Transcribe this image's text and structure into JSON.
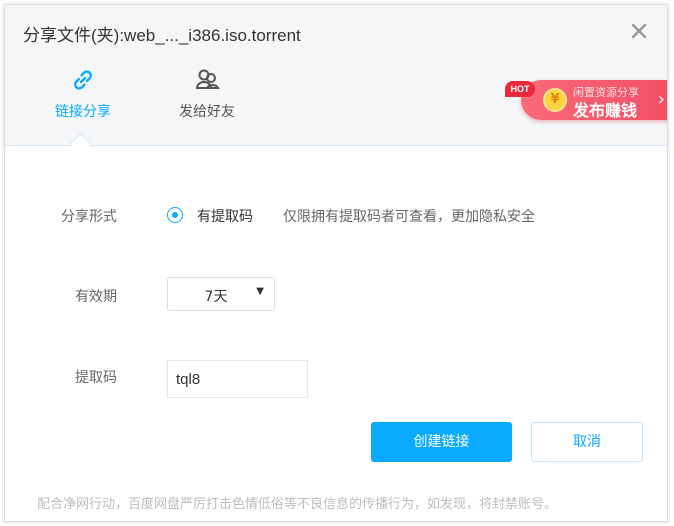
{
  "dialog": {
    "title": "分享文件(夹):web_..._i386.iso.torrent",
    "close_icon": "close-icon"
  },
  "tabs": [
    {
      "label": "链接分享",
      "icon": "link-icon",
      "active": true
    },
    {
      "label": "发给好友",
      "icon": "friends-icon",
      "active": false
    }
  ],
  "promo": {
    "badge": "HOT",
    "coin_symbol": "¥",
    "line1": "闲置资源分享",
    "line2": "发布赚钱",
    "arrow": "›"
  },
  "form": {
    "share_type": {
      "label": "分享形式",
      "option_label": "有提取码",
      "hint": "仅限拥有提取码者可查看，更加隐私安全"
    },
    "validity": {
      "label": "有效期",
      "value": "7天",
      "arrow": "▼"
    },
    "code": {
      "label": "提取码",
      "value": "tql8"
    }
  },
  "buttons": {
    "create": "创建链接",
    "cancel": "取消"
  },
  "notice": "配合净网行动，百度网盘严厉打击色情低俗等不良信息的传播行为，如发现，将封禁账号。",
  "colors": {
    "accent": "#09aaff",
    "promo": "#f24d63",
    "header_bg": "#f5f6f8"
  }
}
